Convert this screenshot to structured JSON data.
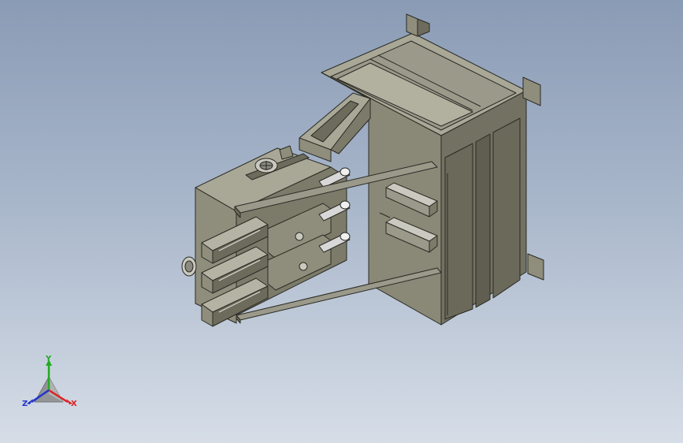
{
  "viewport": {
    "background_top": "#8a9bb5",
    "background_bottom": "#d6dde7"
  },
  "model": {
    "icon": "cad-assembly-model",
    "colors": {
      "body_light": "#a8a796",
      "body_mid": "#8f8e7c",
      "body_dark": "#6c6b5c",
      "edge": "#2a2a24",
      "rod_light": "#e8e8e8",
      "rod_dark": "#9a9a9a"
    }
  },
  "triad": {
    "y_label": "Y",
    "x_label": "X",
    "z_label": "Z",
    "y_color": "#22aa22",
    "x_color": "#dd2222",
    "z_color": "#2233cc"
  }
}
